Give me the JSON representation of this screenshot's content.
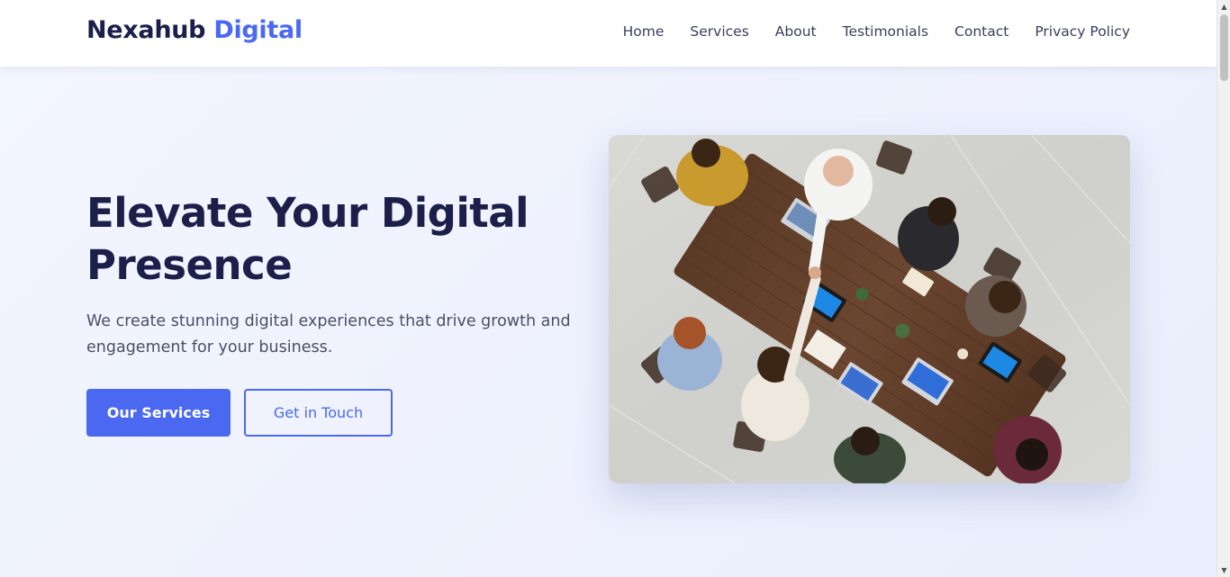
{
  "header": {
    "logo_main": "Nexahub",
    "logo_accent": "Digital",
    "nav": [
      "Home",
      "Services",
      "About",
      "Testimonials",
      "Contact",
      "Privacy Policy"
    ]
  },
  "hero": {
    "title": "Elevate Your Digital Presence",
    "text": "We create stunning digital experiences that drive growth and engagement for your business.",
    "primary_button": "Our Services",
    "secondary_button": "Get in Touch"
  },
  "colors": {
    "accent": "#4a69f0",
    "heading": "#1b1f4a",
    "body_text": "#4a4f66",
    "background": "#eef2fd"
  },
  "icons": {
    "scroll_up": "triangle-up-icon",
    "scroll_down": "triangle-down-icon"
  }
}
